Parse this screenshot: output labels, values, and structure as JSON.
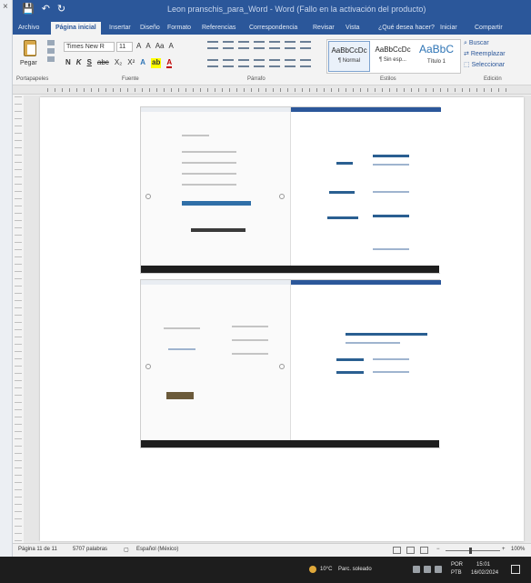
{
  "left_window": {
    "close_glyph": "×"
  },
  "titlebar": {
    "save_glyph": "💾",
    "undo_glyph": "↶",
    "redo_glyph": "↻",
    "title": "Leon pranschis_para_Word - Word (Fallo en la activación del producto)"
  },
  "tabs": [
    "Archivo",
    "Página inicial",
    "Insertar",
    "Diseño",
    "Formato",
    "Referencias",
    "Correspondencia",
    "Revisar",
    "Vista",
    "¿Qué desea hacer?",
    "Iniciar",
    "Compartir"
  ],
  "active_tab_index": 1,
  "ribbon": {
    "paste_label": "Pegar",
    "font_name": "Times New R",
    "font_size": "11",
    "grow_font": "A",
    "shrink_font": "A",
    "change_case": "Aa",
    "clear_format": "A",
    "bold": "N",
    "italic": "K",
    "underline": "S",
    "strikethrough": "abc",
    "subscript": "X₂",
    "superscript": "X²",
    "text_effects": "A",
    "highlight": "ab",
    "font_color": "A",
    "styles": [
      {
        "sample": "AaBbCcDc",
        "name": "¶ Normal",
        "selected": true
      },
      {
        "sample": "AaBbCcDc",
        "name": "¶ Sin esp...",
        "selected": false
      },
      {
        "sample": "AaBbC",
        "name": "Título 1",
        "selected": false
      }
    ],
    "editing": [
      "Buscar",
      "Reemplazar",
      "Seleccionar"
    ],
    "group_labels": [
      "Portapapeles",
      "Fuente",
      "Párrafo",
      "Estilos",
      "Edición"
    ]
  },
  "status": {
    "page": "Página 11 de 11",
    "words": "5707 palabras",
    "language": "Español (México)",
    "zoom": "100%"
  },
  "taskbar": {
    "weather": "10°C",
    "weather_desc": "Parc. soleado",
    "lang": "POR",
    "lang_sub": "PTB",
    "time": "15:01",
    "date": "16/02/2024"
  }
}
